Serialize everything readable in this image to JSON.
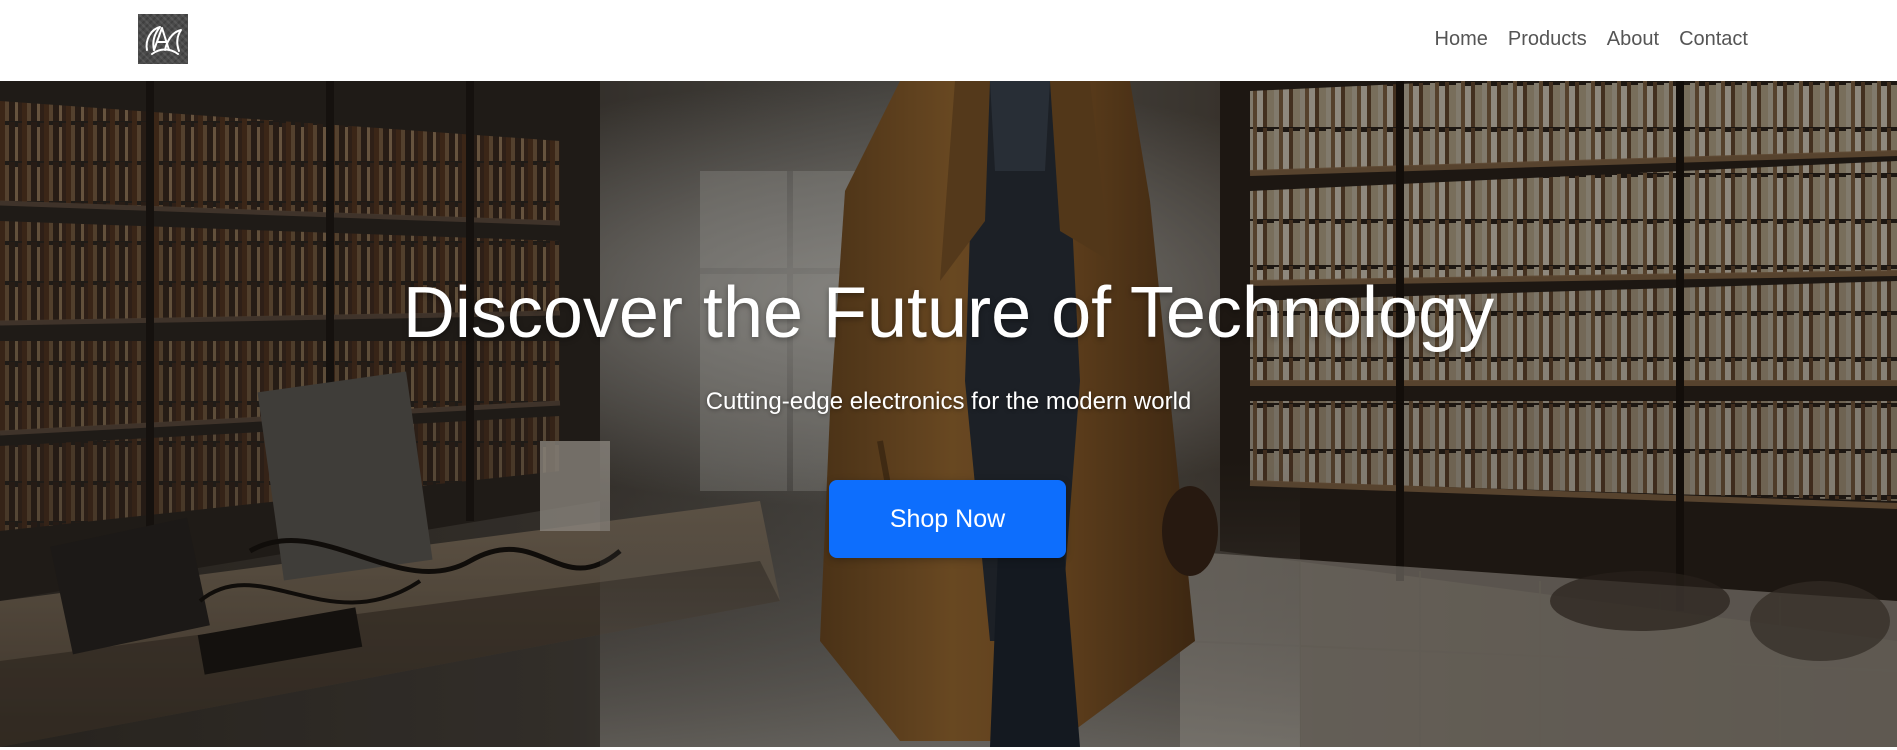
{
  "header": {
    "logo_icon": "monogram-logo-icon",
    "nav": [
      {
        "label": "Home"
      },
      {
        "label": "Products"
      },
      {
        "label": "About"
      },
      {
        "label": "Contact"
      }
    ]
  },
  "hero": {
    "background_image": "library-warehouse-man-in-coat-photo",
    "title": "Discover the Future of Technology",
    "subtitle": "Cutting-edge electronics for the modern world",
    "cta_label": "Shop Now"
  },
  "colors": {
    "accent": "#0d6efd",
    "nav_text": "#555555",
    "hero_text": "#ffffff"
  }
}
